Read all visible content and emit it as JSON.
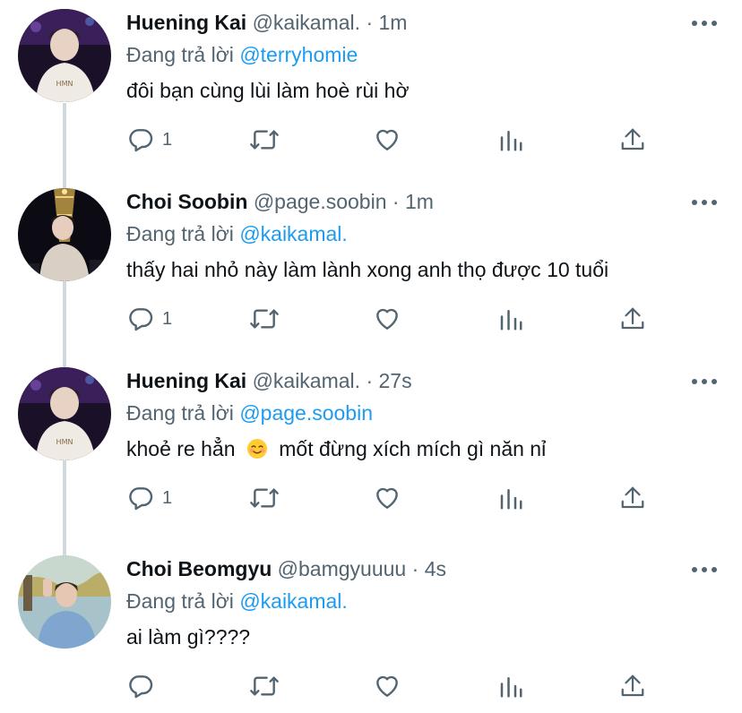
{
  "colors": {
    "accent": "#1d9bf0",
    "text_primary": "#0f1419",
    "text_secondary": "#536471",
    "thread_line": "#cfd9de"
  },
  "replying_prefix": "Đang trả lời",
  "tweets": [
    {
      "name": "Huening Kai",
      "handle": "@kaikamal.",
      "separator": "·",
      "time": "1m",
      "reply_to": "@terryhomie",
      "text": "đôi bạn cùng lùi làm hoè rùi hờ",
      "reply_count": "1",
      "icons": [
        "reply-icon",
        "retweet-icon",
        "like-icon",
        "analytics-icon",
        "share-icon"
      ]
    },
    {
      "name": "Choi Soobin",
      "handle": "@page.soobin",
      "separator": "·",
      "time": "1m",
      "reply_to": "@kaikamal.",
      "text": "thấy hai nhỏ này làm lành xong anh thọ được 10 tuổi",
      "reply_count": "1",
      "icons": [
        "reply-icon",
        "retweet-icon",
        "like-icon",
        "analytics-icon",
        "share-icon"
      ]
    },
    {
      "name": "Huening Kai",
      "handle": "@kaikamal.",
      "separator": "·",
      "time": "27s",
      "reply_to": "@page.soobin",
      "text_before": "khoẻ re hẳn",
      "emoji": "smiling-face-emoji",
      "text_after": "mốt đừng xích mích gì năn nỉ",
      "reply_count": "1",
      "icons": [
        "reply-icon",
        "retweet-icon",
        "like-icon",
        "analytics-icon",
        "share-icon"
      ]
    },
    {
      "name": "Choi Beomgyu",
      "handle": "@bamgyuuuu",
      "separator": "·",
      "time": "4s",
      "reply_to": "@kaikamal.",
      "text": "ai làm gì????",
      "reply_count": "",
      "icons": [
        "reply-icon",
        "retweet-icon",
        "like-icon",
        "analytics-icon",
        "share-icon"
      ]
    }
  ]
}
